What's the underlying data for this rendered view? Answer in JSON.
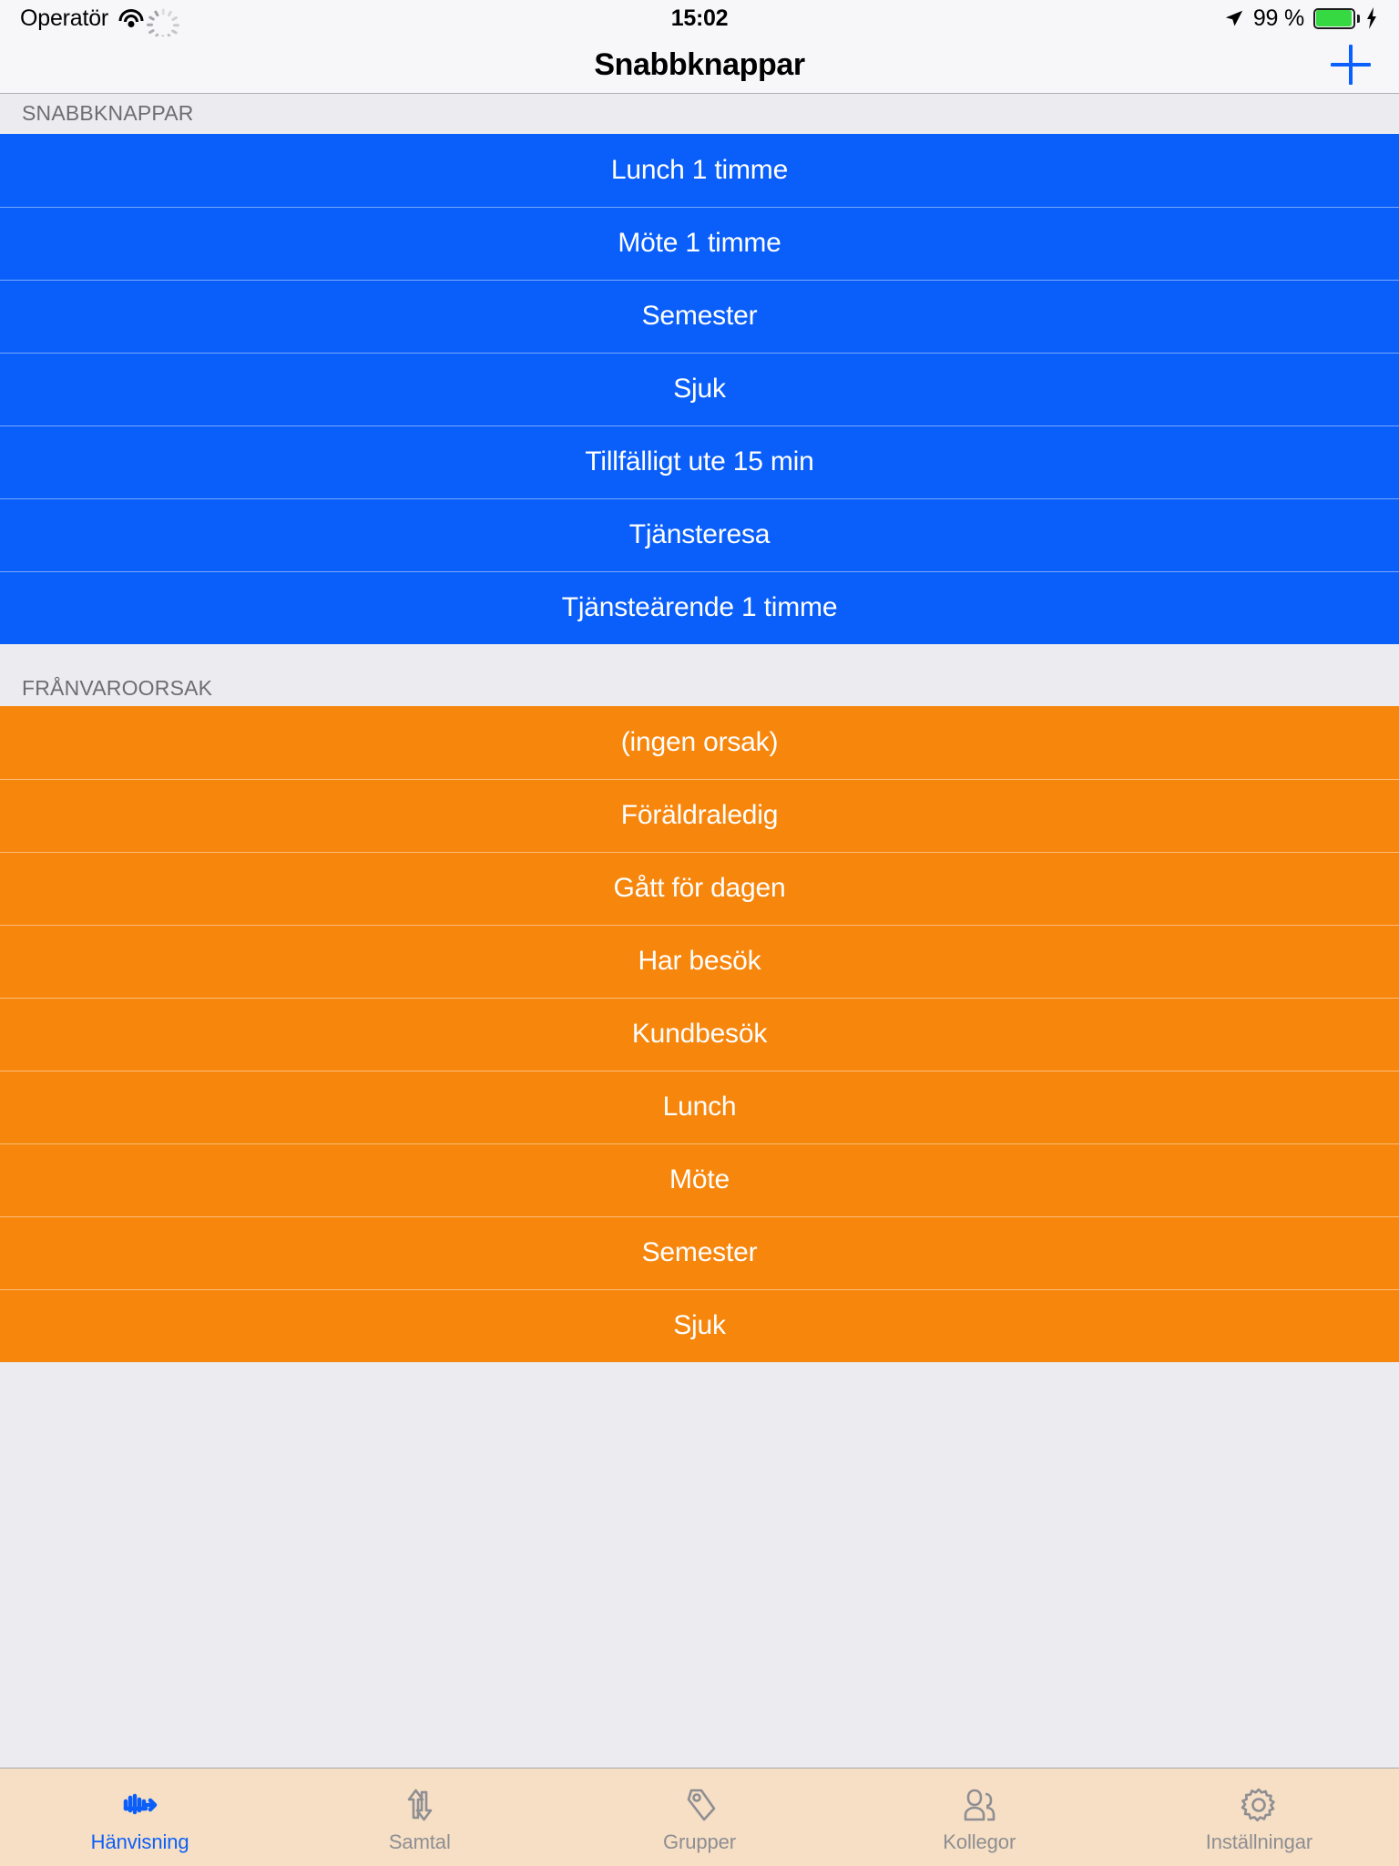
{
  "status_bar": {
    "carrier": "Operatör",
    "wifi_icon": "wifi-icon",
    "activity_icon": "activity-spinner-icon",
    "time": "15:02",
    "location_icon": "location-arrow-icon",
    "battery_percent": "99 %",
    "battery_icon": "battery-full-icon",
    "charging_icon": "charging-bolt-icon"
  },
  "nav_bar": {
    "title": "Snabbknappar",
    "add_button_icon": "plus-icon"
  },
  "sections": [
    {
      "header": "SNABBKNAPPAR",
      "color": "#0a5ffa",
      "rows": [
        "Lunch 1 timme",
        "Möte 1 timme",
        "Semester",
        "Sjuk",
        "Tillfälligt ute 15 min",
        "Tjänsteresa",
        "Tjänsteärende 1 timme"
      ]
    },
    {
      "header": "FRÅNVAROORSAK",
      "color": "#f7860d",
      "rows": [
        "(ingen orsak)",
        "Föräldraledig",
        "Gått för dagen",
        "Har besök",
        "Kundbesök",
        "Lunch",
        "Möte",
        "Semester",
        "Sjuk"
      ]
    }
  ],
  "tab_bar": {
    "active_color": "#0a5ffa",
    "inactive_color": "#8e8e93",
    "tabs": [
      {
        "label": "Hänvisning",
        "icon": "referral-icon",
        "active": true
      },
      {
        "label": "Samtal",
        "icon": "calls-arrows-icon",
        "active": false
      },
      {
        "label": "Grupper",
        "icon": "tag-icon",
        "active": false
      },
      {
        "label": "Kollegor",
        "icon": "people-icon",
        "active": false
      },
      {
        "label": "Inställningar",
        "icon": "gear-icon",
        "active": false
      }
    ]
  }
}
